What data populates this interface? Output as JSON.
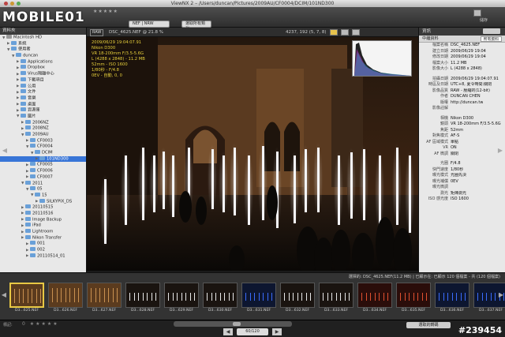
{
  "window": {
    "title": "ViewNX 2 – /Users/duncan/Pictures/2009AU/CF0004/DCIM/101ND300"
  },
  "toolbar": {
    "logo": "MOBILE01",
    "rating_label": "★★★★★",
    "filter_select": "NEF | NRW",
    "reset_label": "選取所有類型",
    "save_label": "儲存"
  },
  "sidebar": {
    "header": "資料夾",
    "items": [
      {
        "label": "Macintosh HD",
        "level": 0,
        "open": true
      },
      {
        "label": "系統",
        "level": 1,
        "open": false
      },
      {
        "label": "使用者",
        "level": 1,
        "open": true
      },
      {
        "label": "duncan",
        "level": 2,
        "open": true
      },
      {
        "label": "Applications",
        "level": 3,
        "open": false
      },
      {
        "label": "Dropbox",
        "level": 3,
        "open": false
      },
      {
        "label": "Virus隔離中心",
        "level": 3,
        "open": false
      },
      {
        "label": "下載項目",
        "level": 3,
        "open": false
      },
      {
        "label": "公用",
        "level": 3,
        "open": false
      },
      {
        "label": "文件",
        "level": 3,
        "open": false
      },
      {
        "label": "音樂",
        "level": 3,
        "open": false
      },
      {
        "label": "桌面",
        "level": 3,
        "open": false
      },
      {
        "label": "資源庫",
        "level": 3,
        "open": false
      },
      {
        "label": "圖片",
        "level": 3,
        "open": true
      },
      {
        "label": "2006NZ",
        "level": 4,
        "open": false
      },
      {
        "label": "2008NZ",
        "level": 4,
        "open": false
      },
      {
        "label": "2009AU",
        "level": 4,
        "open": true
      },
      {
        "label": "CF0003",
        "level": 5,
        "open": false
      },
      {
        "label": "CF0004",
        "level": 5,
        "open": true
      },
      {
        "label": "DCIM",
        "level": 6,
        "open": true
      },
      {
        "label": "101ND300",
        "level": 7,
        "open": false,
        "selected": true
      },
      {
        "label": "CF0005",
        "level": 5,
        "open": false
      },
      {
        "label": "CF0006",
        "level": 5,
        "open": false
      },
      {
        "label": "CF0007",
        "level": 5,
        "open": false
      },
      {
        "label": "2011",
        "level": 4,
        "open": true
      },
      {
        "label": "05",
        "level": 5,
        "open": true
      },
      {
        "label": "15",
        "level": 6,
        "open": true
      },
      {
        "label": "SILKYPIX_DS",
        "level": 7,
        "open": false
      },
      {
        "label": "20110515",
        "level": 4,
        "open": false
      },
      {
        "label": "20110516",
        "level": 4,
        "open": false
      },
      {
        "label": "Image Backup",
        "level": 4,
        "open": false
      },
      {
        "label": "iPad",
        "level": 4,
        "open": false
      },
      {
        "label": "Lightroom",
        "level": 4,
        "open": false
      },
      {
        "label": "Nikon Transfer",
        "level": 4,
        "open": false
      },
      {
        "label": "001",
        "level": 5,
        "open": false
      },
      {
        "label": "002",
        "level": 5,
        "open": false
      },
      {
        "label": "20110514_01",
        "level": 5,
        "open": false
      }
    ]
  },
  "viewer": {
    "raw_badge": "RAW",
    "filename": "DSC_4625.NEF @ 21.8 %",
    "coords": "4237, 192 (5, 7, 8)",
    "overlay": [
      "2009/06/29 19:04:07.91",
      "Nikon D300",
      "VR 18-200mm F/3.5-5.6G",
      "L (4288 x 2848) - 11.2 MB",
      "52mm - ISO 1600",
      "1/80秒 - F/4.8",
      "0EV - 自動, 0, 0"
    ]
  },
  "right_panel": {
    "header": "資訊",
    "tab": "中繼資料",
    "tab_select": "所有資料",
    "section1": [
      {
        "k": "檔案名稱",
        "v": "DSC_4625.NEF"
      },
      {
        "k": "建立日期",
        "v": "2009/06/29 19:04"
      },
      {
        "k": "修改日期",
        "v": "2009/06/29 19:04"
      },
      {
        "k": "檔案大小",
        "v": "11.2 MB"
      },
      {
        "k": "影像大小",
        "v": "L (4288 x 2848)"
      }
    ],
    "section2": [
      {
        "k": "拍攝日期",
        "v": "2009/06/29 19:04:07.91"
      },
      {
        "k": "時區及日期",
        "v": "UTC+8, 夏令時間:關閉"
      },
      {
        "k": "影像品質",
        "v": "RAW - 壓縮的(12-bit)"
      },
      {
        "k": "作者",
        "v": "DUNCAN CHEN"
      },
      {
        "k": "版權",
        "v": "http://duncan.tw"
      },
      {
        "k": "影像註解",
        "v": ""
      }
    ],
    "section3": [
      {
        "k": "相機",
        "v": "Nikon D300"
      },
      {
        "k": "鏡頭",
        "v": "VR 18-200mm F/3.5-5.6G"
      },
      {
        "k": "焦距",
        "v": "52mm"
      },
      {
        "k": "對焦模式",
        "v": "AF-S"
      },
      {
        "k": "AF 區域模式",
        "v": "單點"
      },
      {
        "k": "VR",
        "v": "ON"
      },
      {
        "k": "AF 微調",
        "v": "關閉"
      }
    ],
    "section4": [
      {
        "k": "光圈",
        "v": "F/4.8"
      },
      {
        "k": "快門速度",
        "v": "1/80秒"
      },
      {
        "k": "曝光模式",
        "v": "光圈先決"
      },
      {
        "k": "曝光補償",
        "v": "0EV"
      },
      {
        "k": "曝光微調",
        "v": ""
      },
      {
        "k": "測光",
        "v": "矩陣測光"
      },
      {
        "k": "ISO 感光度",
        "v": "ISO 1600"
      }
    ]
  },
  "filmstrip": {
    "status": "選擇的: DSC_4625.NEF(11.2 MB) | 已顯示在: 已顯示 120 個檔案 - 共 (120 個檔案)",
    "thumbs": [
      {
        "cap": "D3...625.NEF",
        "kind": "church"
      },
      {
        "cap": "D3...626.NEF",
        "kind": "church"
      },
      {
        "cap": "D3...627.NEF",
        "kind": "church"
      },
      {
        "cap": "D3...628.NEF",
        "kind": "lights"
      },
      {
        "cap": "D3...629.NEF",
        "kind": "lights"
      },
      {
        "cap": "D3...630.NEF",
        "kind": "lights"
      },
      {
        "cap": "D3...631.NEF",
        "kind": "blue"
      },
      {
        "cap": "D3...632.NEF",
        "kind": "lights"
      },
      {
        "cap": "D3...633.NEF",
        "kind": "lights"
      },
      {
        "cap": "D3...634.NEF",
        "kind": "red"
      },
      {
        "cap": "D3...635.NEF",
        "kind": "red"
      },
      {
        "cap": "D3...636.NEF",
        "kind": "blue"
      },
      {
        "cap": "D3...637.NEF",
        "kind": "blue"
      }
    ]
  },
  "bottombar": {
    "tag_label": "標記:",
    "page": "60/120",
    "export_label": "選取的轉碼",
    "watermark": "#239454"
  }
}
